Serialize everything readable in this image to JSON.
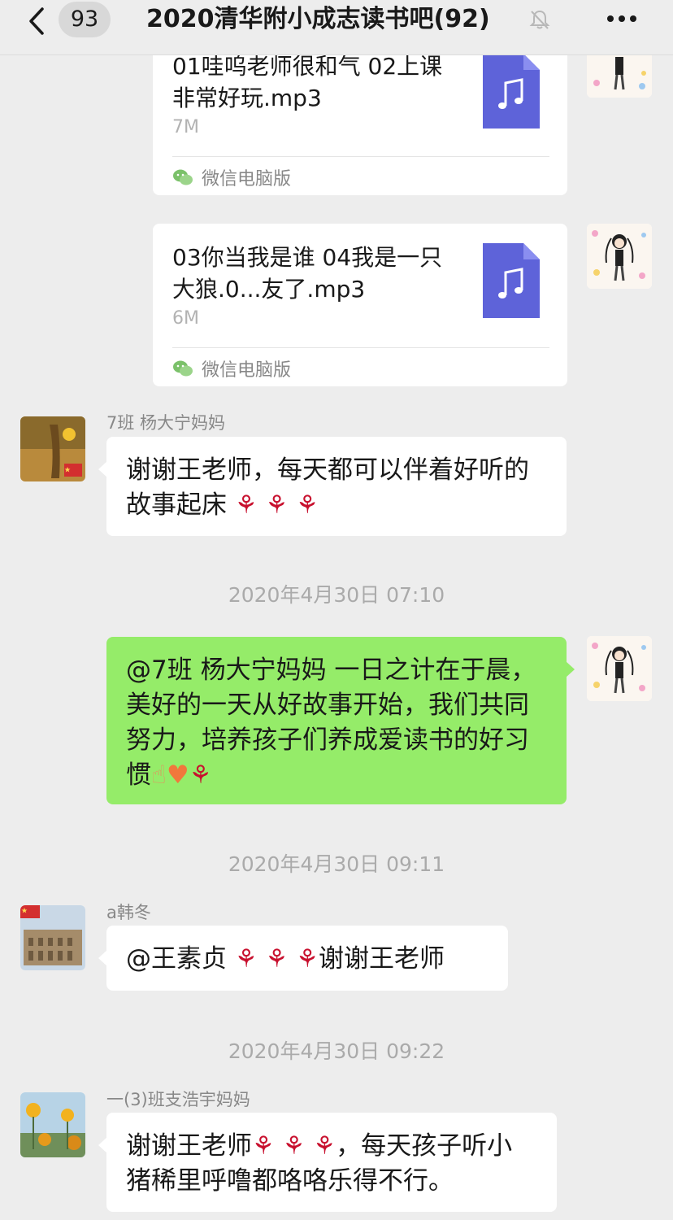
{
  "header": {
    "back_badge": "93",
    "title": "2020清华附小成志读书吧(92)"
  },
  "messages": {
    "file1": {
      "name": "01哇呜老师很和气 02上课非常好玩.mp3",
      "size": "7M",
      "source": "微信电脑版"
    },
    "file2": {
      "name": "03你当我是谁 04我是一只大狼.0...友了.mp3",
      "size": "6M",
      "source": "微信电脑版"
    },
    "msg1": {
      "sender": "7班 杨大宁妈妈",
      "text": "谢谢王老师，每天都可以伴着好听的故事起床"
    },
    "ts1": "2020年4月30日 07:10",
    "msg2": {
      "text": "@7班 杨大宁妈妈 一日之计在于晨，美好的一天从好故事开始，我们共同努力，培养孩子们养成爱读书的好习惯"
    },
    "ts2": "2020年4月30日 09:11",
    "msg3": {
      "sender": "a韩冬",
      "text_a": "@王素贞 ",
      "text_b": "谢谢王老师"
    },
    "ts3": "2020年4月30日 09:22",
    "msg4": {
      "sender": "一(3)班支浩宇妈妈",
      "text_a": "谢谢王老师",
      "text_b": "，每天孩子听小猪稀里呼噜都咯咯乐得不行。"
    }
  },
  "icons": [
    "back-arrow-icon",
    "mute-bell-icon",
    "more-icon",
    "music-file-icon",
    "wechat-icon",
    "rose-emoji",
    "heart-emoji",
    "hand-emoji",
    "china-flag-icon"
  ],
  "colors": {
    "background": "#ededed",
    "bubble_sent": "#95ec69",
    "bubble_received": "#ffffff",
    "file_icon": "#5e63d9"
  }
}
